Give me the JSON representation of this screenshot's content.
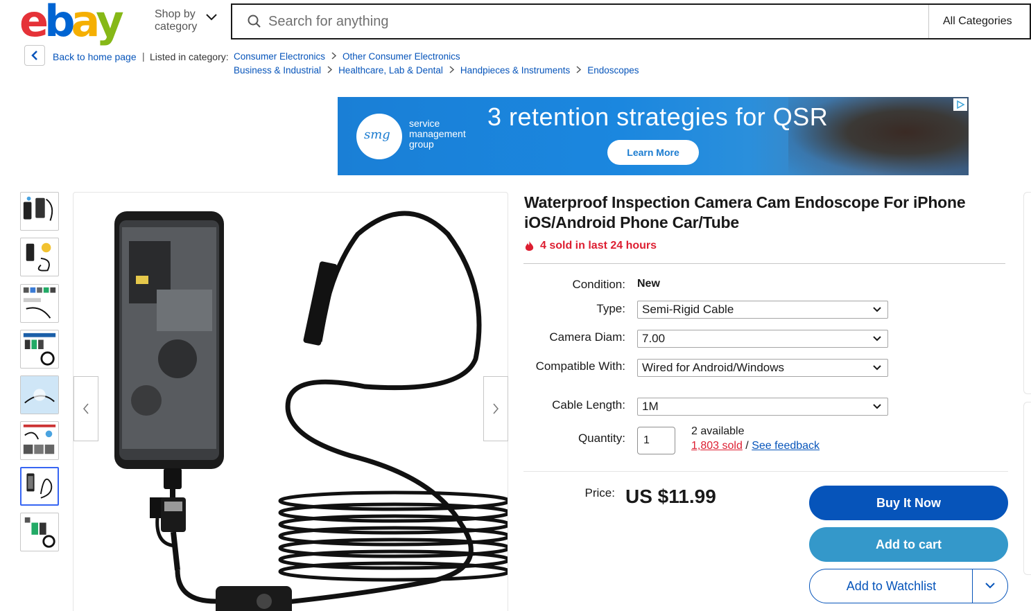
{
  "header": {
    "logo": {
      "letters": [
        "e",
        "b",
        "a",
        "y"
      ],
      "colors": [
        "#e53238",
        "#0064d2",
        "#f5af02",
        "#86b817"
      ]
    },
    "shop_by_category": [
      "Shop by",
      "category"
    ],
    "search": {
      "placeholder": "Search for anything",
      "value": ""
    },
    "category_select": "All Categories"
  },
  "breadcrumb": {
    "back_label": "Back to home page",
    "separator": "|",
    "listed_in": "Listed in category:",
    "row1": [
      "Consumer Electronics",
      "Other Consumer Electronics"
    ],
    "row2": [
      "Business & Industrial",
      "Healthcare, Lab & Dental",
      "Handpieces & Instruments",
      "Endoscopes"
    ]
  },
  "ad": {
    "brand_mark": "smg",
    "brand_lines": [
      "service",
      "management",
      "group"
    ],
    "headline": "3 retention strategies for QSR",
    "cta": "Learn More"
  },
  "gallery": {
    "thumbnail_count": 8,
    "active_index": 6
  },
  "listing": {
    "title": "Waterproof Inspection Camera Cam Endoscope For iPhone iOS/Android Phone Car/Tube",
    "sold_recent": "4 sold in last 24 hours",
    "condition": {
      "label": "Condition:",
      "value": "New"
    },
    "options": [
      {
        "label": "Type:",
        "value": "Semi-Rigid Cable"
      },
      {
        "label": "Camera Diam:",
        "value": "7.00"
      },
      {
        "label": "Compatible With:",
        "value": "Wired for Android/Windows"
      },
      {
        "label": "Cable Length:",
        "value": "1M"
      }
    ],
    "quantity": {
      "label": "Quantity:",
      "value": "1",
      "available": "2 available",
      "sold": "1,803 sold",
      "sep": " / ",
      "feedback": "See feedback"
    },
    "price": {
      "label": "Price:",
      "value": "US $11.99"
    },
    "buttons": {
      "buy": "Buy It Now",
      "cart": "Add to cart",
      "watch": "Add to Watchlist"
    }
  },
  "colors": {
    "link": "#0654ba",
    "buy": "#0654ba",
    "cart": "#3498ca",
    "urgent": "#dd1e31"
  }
}
